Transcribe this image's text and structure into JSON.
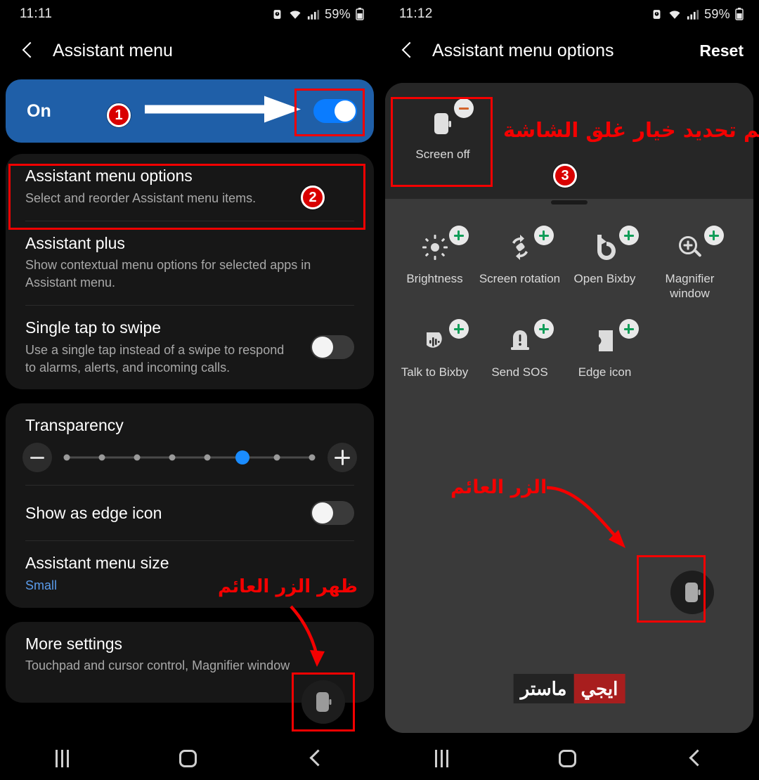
{
  "left": {
    "status": {
      "time": "11:11",
      "battery_pct": "59%",
      "icons": [
        "alarm-icon",
        "wifi-icon",
        "signal-icon",
        "battery-icon"
      ]
    },
    "appbar": {
      "back": "back-chevron",
      "title": "Assistant menu"
    },
    "master_toggle": {
      "label": "On",
      "state": "on"
    },
    "cards": [
      {
        "rows": [
          {
            "title": "Assistant menu options",
            "sub": "Select and reorder Assistant menu items.",
            "control": "none"
          },
          {
            "title": "Assistant plus",
            "sub": "Show contextual menu options for selected apps in Assistant menu.",
            "control": "none"
          },
          {
            "title": "Single tap to swipe",
            "sub": "Use a single tap instead of a swipe to respond to alarms, alerts, and incoming calls.",
            "control": "switch-off"
          }
        ]
      },
      {
        "transparency": {
          "title": "Transparency",
          "steps": 8,
          "active_index": 5,
          "minus_label": "decrease",
          "plus_label": "increase"
        },
        "rows": [
          {
            "title": "Show as edge icon",
            "sub": "",
            "control": "switch-off"
          },
          {
            "title": "Assistant menu size",
            "sub": "Small",
            "control": "none",
            "sub_accent": true
          }
        ]
      },
      {
        "rows": [
          {
            "title": "More settings",
            "sub": "Touchpad and cursor control, Magnifier window",
            "control": "none"
          }
        ]
      }
    ],
    "annotations": {
      "badge1": "1",
      "badge2": "2",
      "arabic_note": "ظهر الزر العائم"
    },
    "navbar": {
      "recents": "recents-icon",
      "home": "home-icon",
      "back": "back-icon"
    }
  },
  "right": {
    "status": {
      "time": "11:12",
      "battery_pct": "59%",
      "icons": [
        "alarm-icon",
        "wifi-icon",
        "signal-icon",
        "battery-icon"
      ]
    },
    "appbar": {
      "back": "back-chevron",
      "title": "Assistant menu options",
      "action": "Reset"
    },
    "selected": [
      {
        "label": "Screen off",
        "icon": "phone-screen-off-icon",
        "badge": "minus"
      }
    ],
    "available": [
      {
        "label": "Brightness",
        "icon": "brightness-icon",
        "badge": "plus"
      },
      {
        "label": "Screen rotation",
        "icon": "screen-rotation-icon",
        "badge": "plus"
      },
      {
        "label": "Open Bixby",
        "icon": "bixby-icon",
        "badge": "plus"
      },
      {
        "label": "Magnifier window",
        "icon": "magnifier-plus-icon",
        "badge": "plus"
      },
      {
        "label": "Talk to Bixby",
        "icon": "talk-to-bixby-icon",
        "badge": "plus"
      },
      {
        "label": "Send SOS",
        "icon": "send-sos-icon",
        "badge": "plus"
      },
      {
        "label": "Edge icon",
        "icon": "edge-icon",
        "badge": "plus"
      }
    ],
    "annotations": {
      "badge3": "3",
      "arabic_note_top": "تم تحديد خيار غلق الشاشة",
      "arabic_note_float": "الزر العائم"
    },
    "watermark": {
      "red_part": "ايجي",
      "dark_part": "ماستر"
    },
    "navbar": {
      "recents": "recents-icon",
      "home": "home-icon",
      "back": "back-icon"
    }
  },
  "colors": {
    "accent_blue": "#0a7cff",
    "master_bar": "#1f5fa8",
    "annotation_red": "#f40000",
    "badge_green": "#0f9d58",
    "badge_orange": "#d2622a",
    "card_bg": "#171717",
    "sheet_bg": "#3a3a3a"
  }
}
